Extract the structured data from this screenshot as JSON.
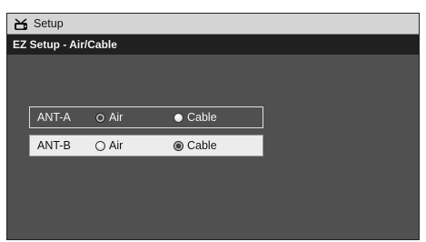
{
  "window": {
    "app_title": "Setup",
    "app_icon": "tv-antenna-icon"
  },
  "header": {
    "title": "EZ Setup - Air/Cable"
  },
  "rows": [
    {
      "label": "ANT-A",
      "options": [
        {
          "label": "Air",
          "selected": true
        },
        {
          "label": "Cable",
          "selected": false
        }
      ],
      "highlighted": false
    },
    {
      "label": "ANT-B",
      "options": [
        {
          "label": "Air",
          "selected": false
        },
        {
          "label": "Cable",
          "selected": true
        }
      ],
      "highlighted": true
    }
  ],
  "colors": {
    "background": "#505050",
    "titlebar": "#d4d4d4",
    "headerbar": "#202020",
    "highlight_row": "#ececec"
  }
}
